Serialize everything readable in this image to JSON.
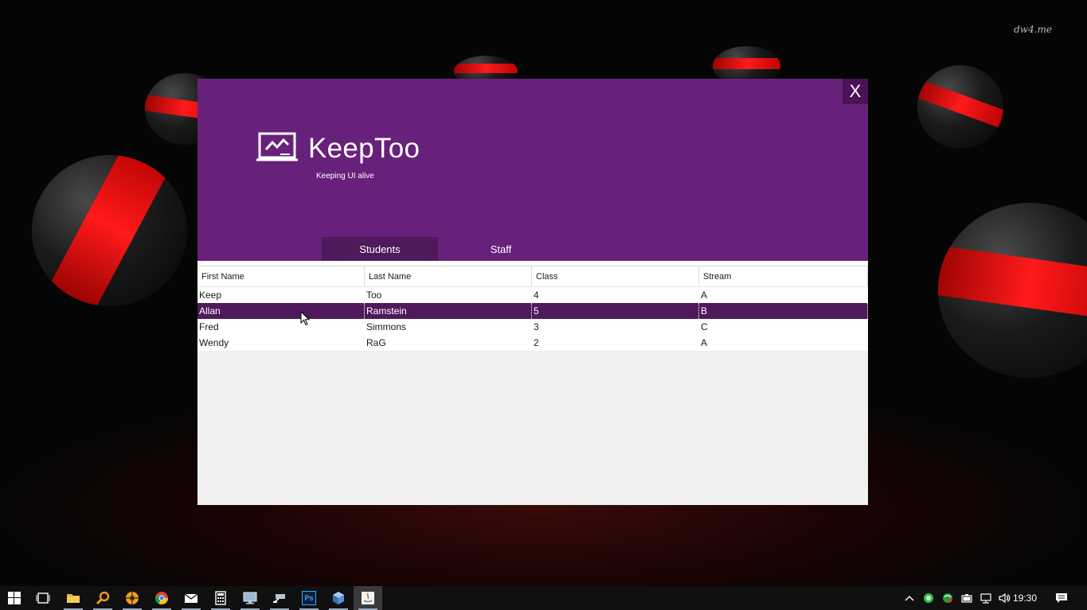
{
  "desktop": {
    "watermark": "dw4.me"
  },
  "app": {
    "close_label": "X",
    "title": "KeepToo",
    "tagline": "Keeping UI alive",
    "accent": "#68217a",
    "accent_dark": "#4e1a5c",
    "tabs": [
      {
        "label": "Students",
        "active": true
      },
      {
        "label": "Staff",
        "active": false
      }
    ],
    "grid": {
      "columns": [
        "First Name",
        "Last Name",
        "Class",
        "Stream"
      ],
      "rows": [
        [
          "Keep",
          "Too",
          "4",
          "A"
        ],
        [
          "Allan",
          "Ramstein",
          "5",
          "B"
        ],
        [
          "Fred",
          "Simmons",
          "3",
          "C"
        ],
        [
          "Wendy",
          "RaG",
          "2",
          "A"
        ]
      ],
      "selected_row": 1
    }
  },
  "taskbar": {
    "items": [
      "start-icon",
      "task-view-icon",
      "file-explorer-icon",
      "search-tool-icon",
      "app-orange-icon",
      "chrome-icon",
      "mail-icon",
      "calculator-icon",
      "remote-desktop-icon",
      "network-tool-icon",
      "photoshop-icon",
      "virtualbox-icon",
      "java-app-icon"
    ],
    "photoshop_label": "Ps",
    "tray_icons": [
      "show-hidden-icons-chevron",
      "status-green-icon",
      "status-green-globe-icon",
      "battery-icon",
      "network-icon",
      "volume-icon",
      "action-center-icon"
    ],
    "time": "19:30"
  }
}
